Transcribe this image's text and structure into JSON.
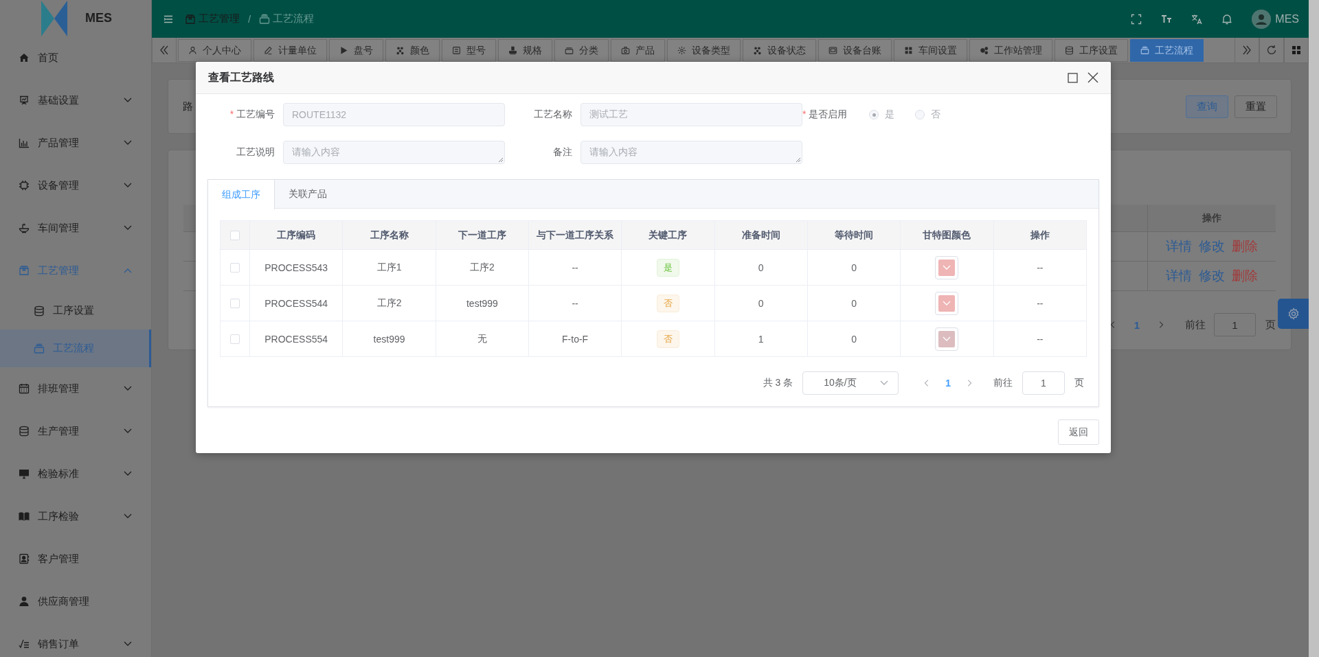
{
  "sidebar": {
    "logo_text": "MES",
    "items": [
      {
        "label": "首页",
        "kind": "link",
        "selected": false
      },
      {
        "label": "基础设置",
        "kind": "group",
        "expanded": false,
        "selected": false
      },
      {
        "label": "产品管理",
        "kind": "group",
        "expanded": false,
        "selected": false
      },
      {
        "label": "设备管理",
        "kind": "group",
        "expanded": false,
        "selected": false
      },
      {
        "label": "车间管理",
        "kind": "group",
        "expanded": false,
        "selected": false
      },
      {
        "label": "工艺管理",
        "kind": "group",
        "expanded": true,
        "selected": true,
        "children": [
          {
            "label": "工序设置",
            "selected": false
          },
          {
            "label": "工艺流程",
            "selected": true
          }
        ]
      },
      {
        "label": "排班管理",
        "kind": "group",
        "expanded": false,
        "selected": false
      },
      {
        "label": "生产管理",
        "kind": "group",
        "expanded": false,
        "selected": false
      },
      {
        "label": "检验标准",
        "kind": "group",
        "expanded": false,
        "selected": false
      },
      {
        "label": "工序检验",
        "kind": "group",
        "expanded": false,
        "selected": false
      },
      {
        "label": "客户管理",
        "kind": "link",
        "selected": false
      },
      {
        "label": "供应商管理",
        "kind": "link",
        "selected": false
      },
      {
        "label": "销售订单",
        "kind": "group",
        "expanded": false,
        "selected": false
      }
    ]
  },
  "header": {
    "breadcrumb": {
      "separator": "/",
      "items": [
        {
          "label": "工艺管理",
          "current": false
        },
        {
          "label": "工艺流程",
          "current": true
        }
      ]
    },
    "user": "MES"
  },
  "tags": {
    "items": [
      {
        "label": "个人中心",
        "selected": false
      },
      {
        "label": "计量单位",
        "selected": false
      },
      {
        "label": "盘号",
        "selected": false
      },
      {
        "label": "颜色",
        "selected": false
      },
      {
        "label": "型号",
        "selected": false
      },
      {
        "label": "规格",
        "selected": false
      },
      {
        "label": "分类",
        "selected": false
      },
      {
        "label": "产品",
        "selected": false
      },
      {
        "label": "设备类型",
        "selected": false
      },
      {
        "label": "设备状态",
        "selected": false
      },
      {
        "label": "设备台账",
        "selected": false
      },
      {
        "label": "车间设置",
        "selected": false
      },
      {
        "label": "工作站管理",
        "selected": false
      },
      {
        "label": "工序设置",
        "selected": false
      },
      {
        "label": "工艺流程",
        "selected": true
      }
    ]
  },
  "background": {
    "search": {
      "label": "路",
      "buttons": [
        {
          "label": "查询",
          "kind": "primary"
        },
        {
          "label": "重置",
          "kind": "default"
        }
      ]
    },
    "table": {
      "columns": [
        "操作"
      ],
      "rows": [
        {
          "actions": [
            {
              "label": "详情",
              "kind": "link"
            },
            {
              "label": "修改",
              "kind": "link"
            },
            {
              "label": "删除",
              "kind": "danger"
            }
          ]
        },
        {
          "actions": [
            {
              "label": "详情",
              "kind": "link"
            },
            {
              "label": "修改",
              "kind": "link"
            },
            {
              "label": "删除",
              "kind": "danger"
            }
          ]
        }
      ]
    },
    "pagination": {
      "page": "1",
      "goto_label": "前往",
      "goto_value": "1",
      "page_suffix": "页"
    }
  },
  "dialog": {
    "title": "查看工艺路线",
    "required_mark": "*",
    "fields": [
      {
        "label": "工艺编号",
        "required": true,
        "kind": "input",
        "value": "ROUTE1132",
        "disabled": true
      },
      {
        "label": "工艺名称",
        "required": false,
        "kind": "input",
        "value": "测试工艺",
        "disabled": true
      },
      {
        "label": "是否启用",
        "required": true,
        "kind": "radio",
        "disabled": true,
        "options": [
          {
            "label": "是",
            "selected": true
          },
          {
            "label": "否",
            "selected": false
          }
        ]
      },
      {
        "label": "工艺说明",
        "required": false,
        "kind": "textarea",
        "placeholder": "请输入内容",
        "disabled": true
      },
      {
        "label": "备注",
        "required": false,
        "kind": "textarea",
        "placeholder": "请输入内容",
        "disabled": true
      }
    ],
    "tabs": [
      {
        "label": "组成工序",
        "selected": true
      },
      {
        "label": "关联产品",
        "selected": false
      }
    ],
    "table": {
      "select_all": false,
      "columns": [
        "工序编码",
        "工序名称",
        "下一道工序",
        "与下一道工序关系",
        "关键工序",
        "准备时间",
        "等待时间",
        "甘特图颜色",
        "操作"
      ],
      "rows": [
        {
          "checked": false,
          "code": "PROCESS543",
          "name": "工序1",
          "next": "工序2",
          "relation": "--",
          "key_process": {
            "label": "是",
            "key": true
          },
          "prep_time": "0",
          "wait_time": "0",
          "color": "#efb4b4",
          "operation": "--"
        },
        {
          "checked": false,
          "code": "PROCESS544",
          "name": "工序2",
          "next": "test999",
          "relation": "--",
          "key_process": {
            "label": "否",
            "key": false
          },
          "prep_time": "0",
          "wait_time": "0",
          "color": "#efb4b4",
          "operation": "--"
        },
        {
          "checked": false,
          "code": "PROCESS554",
          "name": "test999",
          "next": "无",
          "relation": "F-to-F",
          "key_process": {
            "label": "否",
            "key": false
          },
          "prep_time": "1",
          "wait_time": "0",
          "color": "#dcbcbf",
          "operation": "--"
        }
      ]
    },
    "pagination": {
      "total": "共 3 条",
      "page_size": "10条/页",
      "page": "1",
      "goto_label": "前往",
      "goto_value": "1",
      "page_suffix": "页"
    },
    "footer_buttons": [
      "返回"
    ]
  }
}
